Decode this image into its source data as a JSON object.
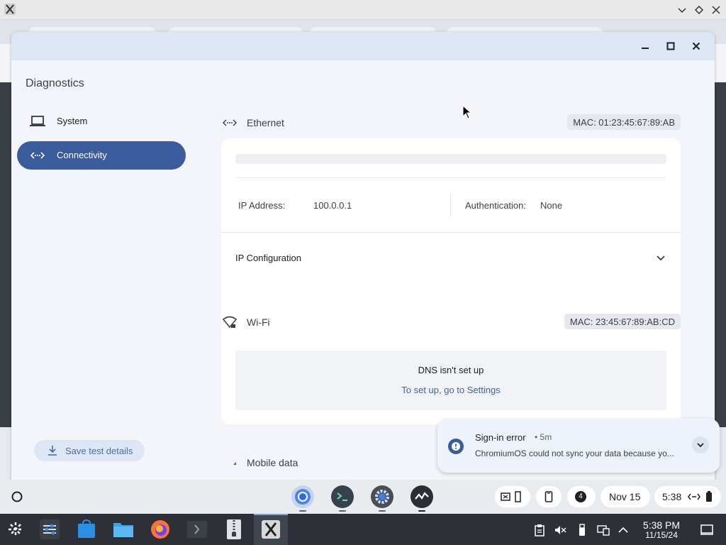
{
  "app": {
    "title": "Diagnostics",
    "nav": [
      {
        "label": "System",
        "icon": "laptop-icon",
        "selected": false
      },
      {
        "label": "Connectivity",
        "icon": "ethernet-icon",
        "selected": true
      }
    ],
    "save_label": "Save test details"
  },
  "ethernet": {
    "name": "Ethernet",
    "mac": "MAC: 01:23:45:67:89:AB",
    "ip_label": "IP Address:",
    "ip_value": "100.0.0.1",
    "auth_label": "Authentication:",
    "auth_value": "None",
    "ip_config_label": "IP Configuration"
  },
  "wifi": {
    "name": "Wi-Fi",
    "mac": "MAC: 23:45:67:89:AB:CD",
    "dns_title": "DNS isn't set up",
    "dns_link": "To set up, go to Settings"
  },
  "mobile": {
    "name": "Mobile data"
  },
  "notification": {
    "title": "Sign-in error",
    "age": "•  5m",
    "body": "ChromiumOS could not sync your data because yo..."
  },
  "shelf": {
    "apps": [
      "chrome-icon",
      "terminal-icon",
      "settings-icon",
      "diagnostics-icon"
    ],
    "notification_count": "4",
    "date": "Nov 15",
    "time": "5:38"
  },
  "taskbar": {
    "time": "5:38 PM",
    "date": "11/15/24"
  },
  "colors": {
    "accent": "#3a5c9c",
    "link": "#3b64b0",
    "window_caption": "#dde6f5",
    "taskbar": "#2d3036"
  }
}
